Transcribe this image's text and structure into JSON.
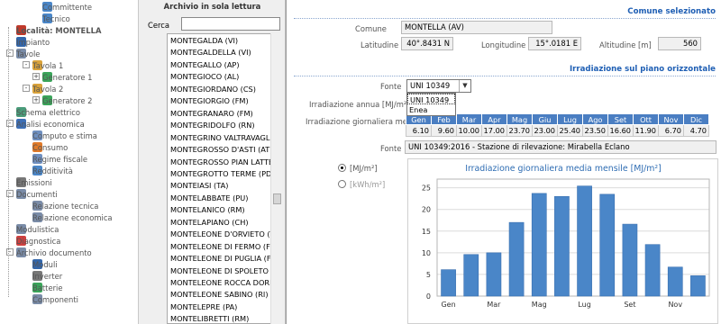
{
  "tree": [
    {
      "label": "Committente",
      "level": 3,
      "icon": "person-icon",
      "color": "#4a86c8"
    },
    {
      "label": "Tecnico",
      "level": 3,
      "icon": "person-icon",
      "color": "#4a86c8"
    },
    {
      "label": "Località: MONTELLA",
      "level": 1,
      "icon": "location-pin-icon",
      "color": "#c0392b",
      "bold": true
    },
    {
      "label": "Impianto",
      "level": 1,
      "icon": "solar-panel-icon",
      "color": "#3366aa"
    },
    {
      "label": "Tavole",
      "level": 1,
      "icon": "table-icon",
      "color": "#7a8ca8",
      "expander": "-"
    },
    {
      "label": "Tavola 1",
      "level": 2,
      "icon": "tavola-icon",
      "color": "#d9a23a",
      "expander": "-"
    },
    {
      "label": "Generatore 1",
      "level": 3,
      "icon": "generator-icon",
      "color": "#3aa55a",
      "expander": "+"
    },
    {
      "label": "Tavola 2",
      "level": 2,
      "icon": "tavola-icon",
      "color": "#d9a23a",
      "expander": "-"
    },
    {
      "label": "Generatore 2",
      "level": 3,
      "icon": "generator-icon",
      "color": "#3aa55a",
      "expander": "+"
    },
    {
      "label": "Schema elettrico",
      "level": 1,
      "icon": "schema-icon",
      "color": "#4a9c7a"
    },
    {
      "label": "Analisi economica",
      "level": 1,
      "icon": "euro-icon",
      "color": "#3d6fb6",
      "expander": "-"
    },
    {
      "label": "Computo e stima",
      "level": 2,
      "icon": "document-icon",
      "color": "#6f8fbf"
    },
    {
      "label": "Consumo",
      "level": 2,
      "icon": "consumption-icon",
      "color": "#e07a2a"
    },
    {
      "label": "Regime fiscale",
      "level": 2,
      "icon": "fiscal-icon",
      "color": "#6f8fbf"
    },
    {
      "label": "Redditività",
      "level": 2,
      "icon": "chart-icon",
      "color": "#4a86c8"
    },
    {
      "label": "Emissioni",
      "level": 1,
      "icon": "emission-icon",
      "color": "#777777"
    },
    {
      "label": "Documenti",
      "level": 1,
      "icon": "folder-icon",
      "color": "#7a8ca8",
      "expander": "-"
    },
    {
      "label": "Relazione tecnica",
      "level": 2,
      "icon": "report-icon",
      "color": "#7a8ca8"
    },
    {
      "label": "Relazione economica",
      "level": 2,
      "icon": "report-icon",
      "color": "#7a8ca8"
    },
    {
      "label": "Modulistica",
      "level": 1,
      "icon": "forms-icon",
      "color": "#7a8ca8"
    },
    {
      "label": "Diagnostica",
      "level": 1,
      "icon": "diagnostics-icon",
      "color": "#d04040"
    },
    {
      "label": "Archivio documento",
      "level": 1,
      "icon": "archive-icon",
      "color": "#7a8ca8",
      "expander": "-"
    },
    {
      "label": "Moduli",
      "level": 2,
      "icon": "module-icon",
      "color": "#3366aa"
    },
    {
      "label": "Inverter",
      "level": 2,
      "icon": "inverter-icon",
      "color": "#777777"
    },
    {
      "label": "Batterie",
      "level": 2,
      "icon": "battery-icon",
      "color": "#3aa55a"
    },
    {
      "label": "Componenti",
      "level": 2,
      "icon": "component-icon",
      "color": "#7a8ca8"
    }
  ],
  "archive": {
    "title": "Archivio in sola lettura",
    "search_label": "Cerca",
    "search_value": "",
    "items": [
      "MONTEGALDA (VI)",
      "MONTEGALDELLA (VI)",
      "MONTEGALLO (AP)",
      "MONTEGIOCO (AL)",
      "MONTEGIORDANO (CS)",
      "MONTEGIORGIO (FM)",
      "MONTEGRANARO (FM)",
      "MONTEGRIDOLFO (RN)",
      "MONTEGRINO VALTRAVAGLIA",
      "MONTEGROSSO D'ASTI (AT)",
      "MONTEGROSSO PIAN LATTE (I",
      "MONTEGROTTO TERME (PD)",
      "MONTEIASI (TA)",
      "MONTELABBATE (PU)",
      "MONTELANICO (RM)",
      "MONTELAPIANO (CH)",
      "MONTELEONE D'ORVIETO (TR)",
      "MONTELEONE DI FERMO (FM)",
      "MONTELEONE DI PUGLIA (FG)",
      "MONTELEONE DI SPOLETO (PG",
      "MONTELEONE ROCCA DORIA (",
      "MONTELEONE SABINO (RI)",
      "MONTELEPRE (PA)",
      "MONTELIBRETTI (RM)"
    ]
  },
  "comune_section": {
    "heading": "Comune selezionato",
    "comune_label": "Comune",
    "comune_value": "MONTELLA (AV)",
    "latitudine_label": "Latitudine",
    "latitudine_value": "40°.8431 N",
    "longitudine_label": "Longitudine",
    "longitudine_value": "15°.0181 E",
    "altitudine_label": "Altitudine [m]",
    "altitudine_value": "560"
  },
  "irradiazione_section": {
    "heading": "Irradiazione sul piano orizzontale",
    "fonte_label": "Fonte",
    "fonte_selected": "UNI 10349",
    "fonte_options": [
      "UNI 10349",
      "Enea"
    ],
    "annua_label": "Irradiazione annua [MJ/m²]",
    "giornaliera_label": "Irradiazione giornaliera media",
    "months": [
      "Gen",
      "Feb",
      "Mar",
      "Apr",
      "Mag",
      "Giu",
      "Lug",
      "Ago",
      "Set",
      "Ott",
      "Nov",
      "Dic"
    ],
    "values": [
      "6.10",
      "9.60",
      "10.00",
      "17.00",
      "23.70",
      "23.00",
      "25.40",
      "23.50",
      "16.60",
      "11.90",
      "6.70",
      "4.70"
    ],
    "fonte2_label": "Fonte",
    "fonte2_value": "UNI 10349:2016 - Stazione di rilevazione: Mirabella Eclano",
    "unit_mj": "[MJ/m²]",
    "unit_kwh": "[kWh/m²]"
  },
  "chart_data": {
    "type": "bar",
    "title": "Irradiazione giornaliera media mensile [MJ/m²]",
    "categories": [
      "Gen",
      "Feb",
      "Mar",
      "Apr",
      "Mag",
      "Giu",
      "Lug",
      "Ago",
      "Set",
      "Ott",
      "Nov",
      "Dic"
    ],
    "values": [
      6.1,
      9.6,
      10.0,
      17.0,
      23.7,
      23.0,
      25.4,
      23.5,
      16.6,
      11.9,
      6.7,
      4.7
    ],
    "x_tick_labels": [
      "Gen",
      "Mar",
      "Mag",
      "Lug",
      "Set",
      "Nov"
    ],
    "y_ticks": [
      0,
      5,
      10,
      15,
      20,
      25
    ],
    "ylim": [
      0,
      27
    ],
    "grid": true,
    "bar_color": "#4a86c8",
    "title_color": "#2f6db3"
  }
}
